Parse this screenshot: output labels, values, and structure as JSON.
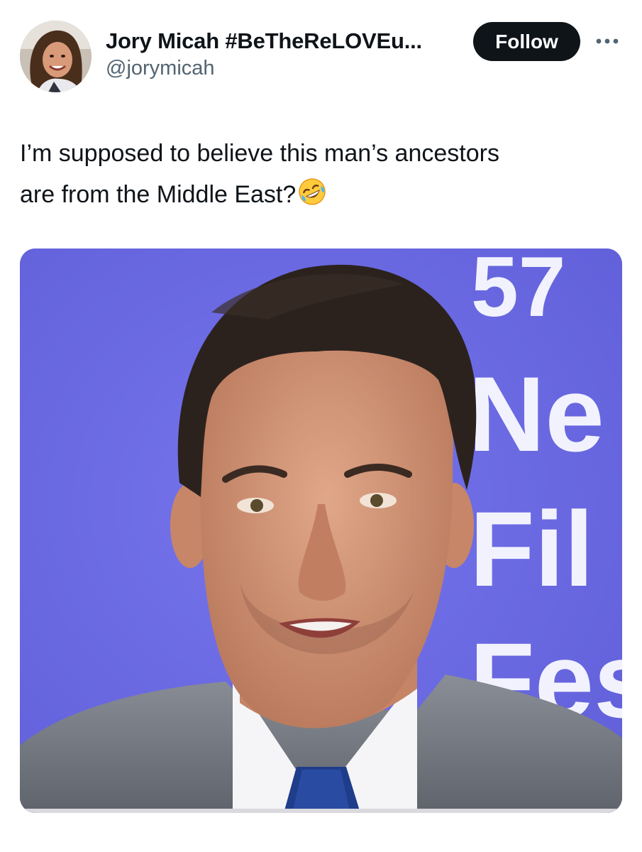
{
  "author": {
    "display_name": "Jory Micah #BeTheReLOVEu...",
    "handle": "@jorymicah"
  },
  "header": {
    "follow_label": "Follow",
    "more_icon": "more-horizontal-icon"
  },
  "tweet": {
    "text_line_1": "I’m supposed to believe this man’s ancestors",
    "text_line_2": "are from the Middle East?",
    "emoji": "rolling-on-floor-laughing-emoji"
  },
  "media": {
    "backdrop_text": {
      "line_1": "57",
      "line_2": "Ne",
      "line_3": "Fil",
      "line_4": "Fes"
    },
    "backdrop_color": "#6f6ee8"
  },
  "colors": {
    "text_primary": "#0f1419",
    "text_secondary": "#536471",
    "follow_bg": "#0f1419",
    "follow_text": "#ffffff"
  }
}
